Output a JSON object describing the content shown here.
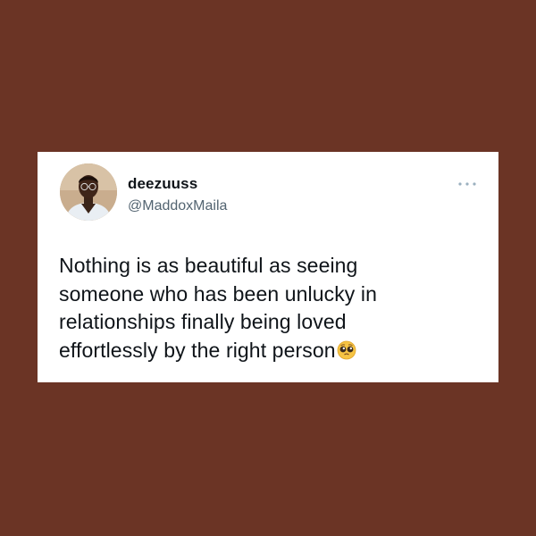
{
  "colors": {
    "background": "#6b3425",
    "card": "#ffffff",
    "text": "#0f1419",
    "secondary_text": "#536471",
    "more_dots": "#9bb0bf"
  },
  "tweet": {
    "display_name": "deezuuss",
    "handle": "@MaddoxMaila",
    "text_lines": [
      "Nothing is as beautiful as seeing",
      "someone who has been unlucky in",
      "relationships finally being loved",
      "effortlessly by the right person"
    ],
    "emoji": "pleading-face-emoji",
    "more_icon": "more-horizontal-icon",
    "avatar_icon": "avatar"
  }
}
